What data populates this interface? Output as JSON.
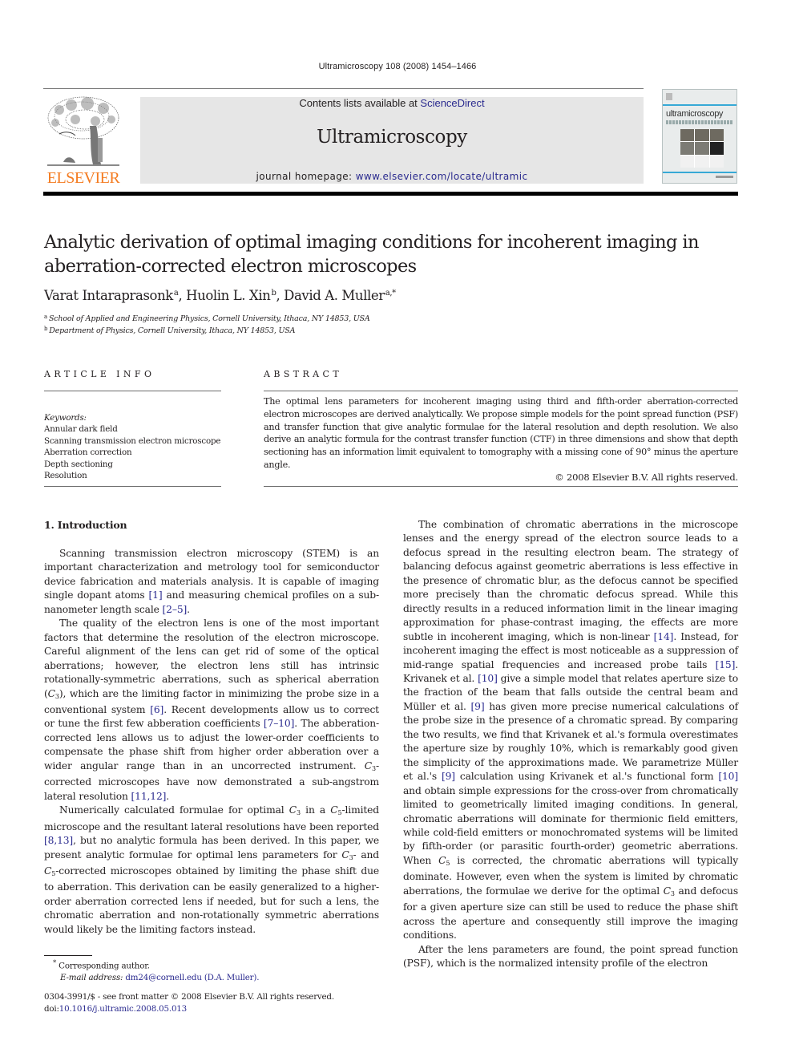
{
  "header": {
    "journal_reference": "Ultramicroscopy 108 (2008) 1454–1466",
    "contents_prefix": "Contents lists available at ",
    "contents_link": "ScienceDirect",
    "journal_name": "Ultramicroscopy",
    "homepage_prefix": "journal homepage: ",
    "homepage_link": "www.elsevier.com/locate/ultramic",
    "publisher_wordmark": "ELSEVIER",
    "cover_title": "ultramicroscopy",
    "colors": {
      "publisher_orange": "#f47b20",
      "link_blue": "#2b2b8f",
      "masthead_gray": "#e6e6e6",
      "cover_accent": "#37a9d6"
    }
  },
  "article": {
    "title": "Analytic derivation of optimal imaging conditions for incoherent imaging in aberration-corrected electron microscopes",
    "authors": [
      {
        "name": "Varat Intaraprasonk",
        "marks": "a"
      },
      {
        "name": "Huolin L. Xin",
        "marks": "b"
      },
      {
        "name": "David A. Muller",
        "marks": "a,*"
      }
    ],
    "author_separator": ", ",
    "affiliations": [
      {
        "mark": "a",
        "text": "School of Applied and Engineering Physics, Cornell University, Ithaca, NY 14853, USA"
      },
      {
        "mark": "b",
        "text": "Department of Physics, Cornell University, Ithaca, NY 14853, USA"
      }
    ]
  },
  "article_info": {
    "heading": "ARTICLE INFO",
    "keywords_label": "Keywords:",
    "keywords": [
      "Annular dark field",
      "Scanning transmission electron microscope",
      "Aberration correction",
      "Depth sectioning",
      "Resolution"
    ]
  },
  "abstract": {
    "heading": "ABSTRACT",
    "text": "The optimal lens parameters for incoherent imaging using third and fifth-order aberration-corrected electron microscopes are derived analytically. We propose simple models for the point spread function (PSF) and transfer function that give analytic formulae for the lateral resolution and depth resolution. We also derive an analytic formula for the contrast transfer function (CTF) in three dimensions and show that depth sectioning has an information limit equivalent to tomography with a missing cone of 90° minus the aperture angle.",
    "copyright": "© 2008 Elsevier B.V. All rights reserved."
  },
  "body": {
    "section_heading": "1.  Introduction",
    "left_paragraphs": [
      [
        {
          "t": "Scanning transmission electron microscopy (STEM) is an important characterization and metrology tool for semiconductor device fabrication and materials analysis. It is capable of imaging single dopant atoms "
        },
        {
          "ref": "[1]"
        },
        {
          "t": " and measuring chemical profiles on a sub-nanometer length scale "
        },
        {
          "ref": "[2–5]"
        },
        {
          "t": "."
        }
      ],
      [
        {
          "t": "The quality of the electron lens is one of the most important factors that determine the resolution of the electron microscope. Careful alignment of the lens can get rid of some of the optical aberrations; however, the electron lens still has intrinsic rotationally-symmetric aberrations, such as spherical aberration ("
        },
        {
          "sym": "C",
          "sub": "3"
        },
        {
          "t": "), which are the limiting factor in minimizing the probe size in a conventional system "
        },
        {
          "ref": "[6]"
        },
        {
          "t": ". Recent developments allow us to correct or tune the first few abberation coefficients "
        },
        {
          "ref": "[7–10]"
        },
        {
          "t": ". The abberation-corrected lens allows us to adjust the lower-order coefficients to compensate the phase shift from higher order abberation over a wider angular range than in an uncorrected instrument. "
        },
        {
          "sym": "C",
          "sub": "3"
        },
        {
          "t": "-corrected microscopes have now demonstrated a sub-angstrom lateral resolution "
        },
        {
          "ref": "[11,12]"
        },
        {
          "t": "."
        }
      ],
      [
        {
          "t": "Numerically calculated formulae for optimal "
        },
        {
          "sym": "C",
          "sub": "3"
        },
        {
          "t": " in a "
        },
        {
          "sym": "C",
          "sub": "5"
        },
        {
          "t": "-limited microscope and the resultant lateral resolutions have been reported "
        },
        {
          "ref": "[8,13]"
        },
        {
          "t": ", but no analytic formula has been derived. In this paper, we present analytic formulae for optimal lens parameters for "
        },
        {
          "sym": "C",
          "sub": "3"
        },
        {
          "t": "- and "
        },
        {
          "sym": "C",
          "sub": "5"
        },
        {
          "t": "-corrected microscopes obtained by limiting the phase shift due to aberration. This derivation can be easily generalized to a higher-order aberration corrected lens if needed, but for such a lens, the chromatic aberration and non-rotationally symmetric aberrations would likely be the limiting factors instead."
        }
      ]
    ],
    "right_paragraphs": [
      [
        {
          "t": "The combination of chromatic aberrations in the microscope lenses and the energy spread of the electron source leads to a defocus spread in the resulting electron beam. The strategy of balancing defocus against geometric aberrations is less effective in the presence of chromatic blur, as the defocus cannot be specified more precisely than the chromatic defocus spread. While this directly results in a reduced information limit in the linear imaging approximation for phase-contrast imaging, the effects are more subtle in incoherent imaging, which is non-linear "
        },
        {
          "ref": "[14]"
        },
        {
          "t": ". Instead, for incoherent imaging the effect is most noticeable as a suppression of mid-range spatial frequencies and increased probe tails "
        },
        {
          "ref": "[15]"
        },
        {
          "t": ". Krivanek et al. "
        },
        {
          "ref": "[10]"
        },
        {
          "t": " give a simple model that relates aperture size to the fraction of the beam that falls outside the central beam and Müller et al. "
        },
        {
          "ref": "[9]"
        },
        {
          "t": " has given more precise numerical calculations of the probe size in the presence of a chromatic spread. By comparing the two results, we find that Krivanek et al.'s formula overestimates the aperture size by roughly 10%, which is remarkably good given the simplicity of the approximations made. We parametrize Müller et al.'s "
        },
        {
          "ref": "[9]"
        },
        {
          "t": " calculation using Krivanek et al.'s functional form "
        },
        {
          "ref": "[10]"
        },
        {
          "t": " and obtain simple expressions for the cross-over from chromatically limited to geometrically limited imaging conditions. In general, chromatic aberrations will dominate for thermionic field emitters, while cold-field emitters or monochromated systems will be limited by fifth-order (or parasitic fourth-order) geometric aberrations. When "
        },
        {
          "sym": "C",
          "sub": "5"
        },
        {
          "t": " is corrected, the chromatic aberrations will typically dominate. However, even when the system is limited by chromatic aberrations, the formulae we derive for the optimal "
        },
        {
          "sym": "C",
          "sub": "3"
        },
        {
          "t": " and defocus for a given aperture size can still be used to reduce the phase shift across the aperture and consequently still improve the imaging conditions."
        }
      ],
      [
        {
          "t": "After the lens parameters are found, the point spread function (PSF), which is the normalized intensity profile of the electron"
        }
      ]
    ]
  },
  "footnote": {
    "mark": "*",
    "corresponding": "Corresponding author.",
    "email_label": "E-mail address:",
    "email": "dm24@cornell.edu",
    "email_owner": "(D.A. Muller)."
  },
  "front_matter": {
    "issn_line": "0304-3991/$ - see front matter © 2008 Elsevier B.V. All rights reserved.",
    "doi_label": "doi:",
    "doi": "10.1016/j.ultramic.2008.05.013"
  }
}
